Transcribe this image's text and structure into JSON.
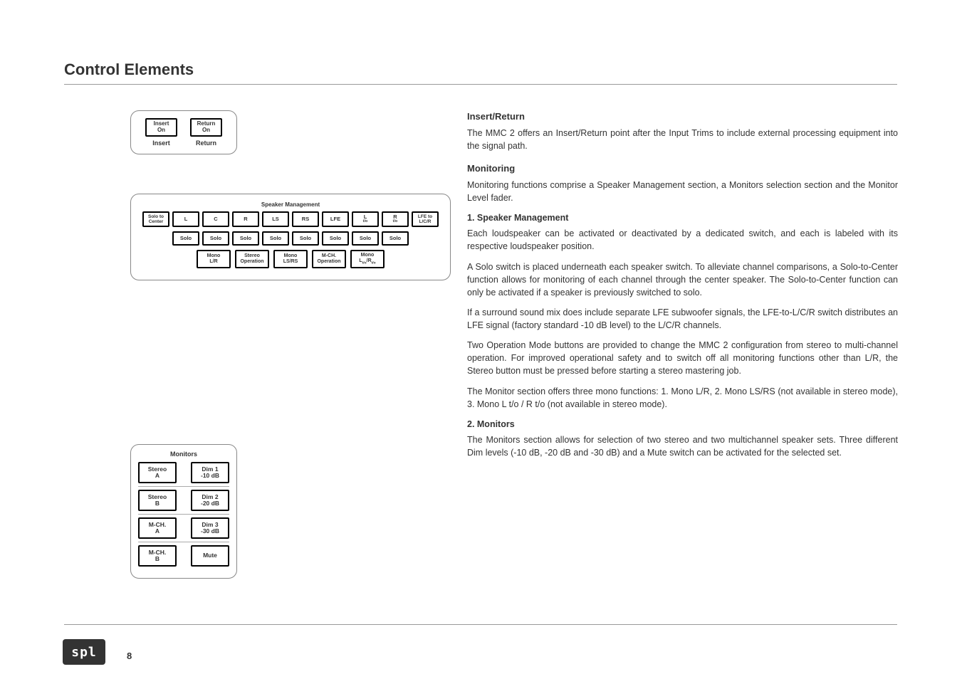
{
  "title": "Control Elements",
  "insert_panel": {
    "btn1": {
      "l1": "Insert",
      "l2": "On"
    },
    "btn2": {
      "l1": "Return",
      "l2": "On"
    },
    "lab1": "Insert",
    "lab2": "Return"
  },
  "spk": {
    "title": "Speaker Management",
    "row1": [
      "Solo to\nCenter",
      "L",
      "C",
      "R",
      "LS",
      "RS",
      "LFE",
      "L<sub>t/o</sub>",
      "R<sub>t/o</sub>",
      "LFE to\nL/C/R"
    ],
    "row2": [
      "Solo",
      "Solo",
      "Solo",
      "Solo",
      "Solo",
      "Solo",
      "Solo",
      "Solo"
    ],
    "row3": [
      {
        "l1": "Mono",
        "l2": "L/R"
      },
      {
        "l1": "Stereo",
        "l2": "Operation"
      },
      {
        "l1": "Mono",
        "l2": "LS/RS"
      },
      {
        "l1": "M-CH.",
        "l2": "Operation"
      },
      {
        "l1": "Mono",
        "l2": "L<sub>t/o</sub>/R<sub>t/o</sub>"
      }
    ]
  },
  "mon": {
    "title": "Monitors",
    "rows": [
      [
        {
          "l1": "Stereo",
          "l2": "A"
        },
        {
          "l1": "Dim 1",
          "l2": "-10 dB"
        }
      ],
      [
        {
          "l1": "Stereo",
          "l2": "B"
        },
        {
          "l1": "Dim 2",
          "l2": "-20 dB"
        }
      ],
      [
        {
          "l1": "M-CH.",
          "l2": "A"
        },
        {
          "l1": "Dim 3",
          "l2": "-30 dB"
        }
      ],
      [
        {
          "l1": "M-CH.",
          "l2": "B"
        },
        {
          "l1": "Mute",
          "l2": ""
        }
      ]
    ]
  },
  "text": {
    "h1": "Insert/Return",
    "p1": "The MMC 2 offers an Insert/Return point after the Input Trims to include external processing equipment into the signal path.",
    "h2": "Monitoring",
    "p2": "Monitoring functions comprise a Speaker Management section, a Monitors selection section and the Monitor Level fader.",
    "s1": "1. Speaker Management",
    "p3": "Each loudspeaker can be activated or deactivated by a dedicated switch, and each is labeled with its respective loudspeaker position.",
    "p4": "A Solo switch is placed underneath each speaker switch. To alleviate channel comparisons, a Solo-to-Center function allows for monitoring of each channel through the center speaker. The Solo-to-Center function can only be activated if a speaker is previously switched to solo.",
    "p5": "If a surround sound mix does include separate LFE subwoofer signals, the LFE-to-L/C/R switch distributes an LFE signal (factory standard -10 dB level) to the L/C/R channels.",
    "p6": "Two Operation Mode buttons are provided to change the MMC 2 configuration from stereo to multi-channel operation. For improved operational safety and to switch off all monitoring functions other than L/R, the Stereo button must be pressed before starting a stereo mastering job.",
    "p7": "The Monitor section offers three mono functions: 1. Mono L/R, 2. Mono LS/RS (not available in stereo mode), 3. Mono L t/o / R t/o (not available in stereo mode).",
    "s2": "2. Monitors",
    "p8": "The Monitors section allows for selection of two stereo and two multichannel speaker sets. Three different Dim levels (-10 dB, -20 dB and -30 dB) and a Mute switch can be activated for the selected set."
  },
  "logo": "spl",
  "page": "8"
}
